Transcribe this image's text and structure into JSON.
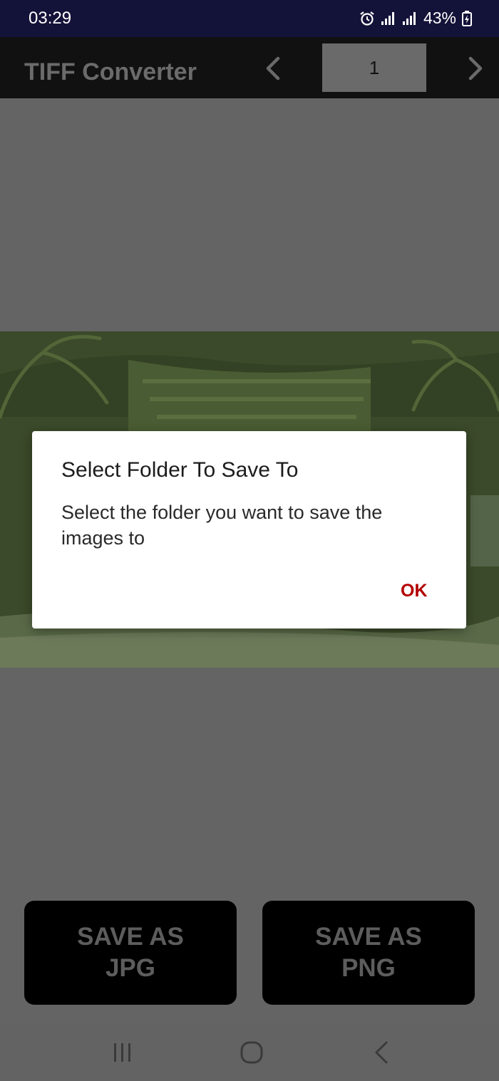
{
  "status_bar": {
    "time": "03:29",
    "battery": "43%",
    "icons": [
      "alarm-icon",
      "signal-icon",
      "signal-icon",
      "battery-charging-icon"
    ]
  },
  "toolbar": {
    "title": "TIFF Converter",
    "page_number": "1",
    "prev_icon": "chevron-left-icon",
    "next_icon": "chevron-right-icon"
  },
  "dialog": {
    "title": "Select Folder To Save To",
    "message": "Select the folder you want to save the images to",
    "ok_label": "OK",
    "accent_color": "#b30000"
  },
  "buttons": {
    "save_jpg_line1": "SAVE AS",
    "save_jpg_line2": "JPG",
    "save_png_line1": "SAVE AS",
    "save_png_line2": "PNG"
  },
  "nav_bar": {
    "icons": [
      "recents-icon",
      "home-icon",
      "back-icon"
    ]
  }
}
